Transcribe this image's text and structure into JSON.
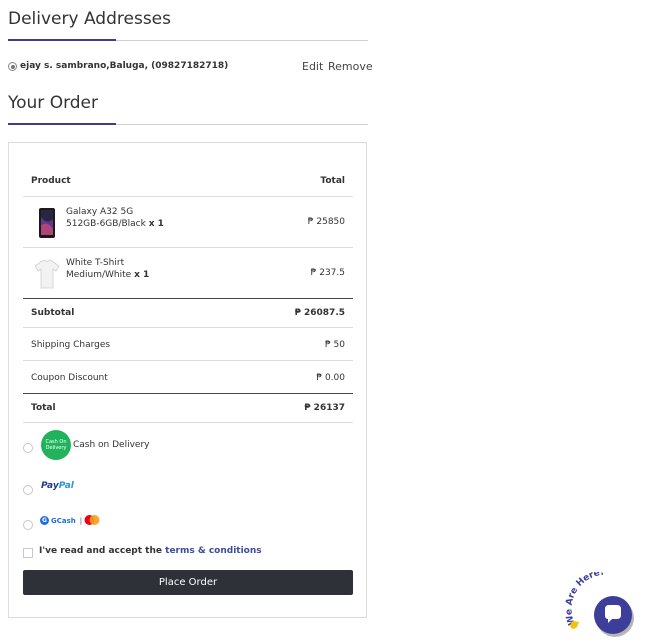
{
  "delivery": {
    "title": "Delivery Addresses",
    "address_text": "ejay s. sambrano,Baluga, (09827182718)",
    "edit_label": "Edit",
    "remove_label": "Remove"
  },
  "order": {
    "title": "Your Order",
    "header": {
      "product": "Product",
      "total": "Total"
    },
    "items": [
      {
        "name_line1": "Galaxy A32 5G",
        "name_line2": "512GB-6GB/Black",
        "qty": "x 1",
        "total": "₱ 25850",
        "image_icon": "phone-image"
      },
      {
        "name_line1": "White T-Shirt",
        "name_line2": "Medium/White",
        "qty": "x 1",
        "total": "₱ 237.5",
        "image_icon": "tshirt-image"
      }
    ],
    "subtotal": {
      "label": "Subtotal",
      "value": "₱ 26087.5"
    },
    "shipping": {
      "label": "Shipping Charges",
      "value": "₱ 50"
    },
    "coupon": {
      "label": "Coupon Discount",
      "value": "₱ 0.00"
    },
    "total": {
      "label": "Total",
      "value": "₱ 26137"
    }
  },
  "payment": {
    "cod_label": "Cash on Delivery",
    "cod_badge_text": "Cash On Delivery",
    "paypal_part1": "Pay",
    "paypal_part2": "Pal",
    "gcash_label": "GCash",
    "gcash_sep": "|"
  },
  "terms": {
    "prefix": "I've read and accept the ",
    "link": "terms & conditions"
  },
  "place_order_label": "Place Order",
  "chat_widget": {
    "arc_text": "We Are Here!",
    "accent": "#3d3d9a"
  },
  "colors": {
    "accent": "#3d3d8f",
    "button": "#2e3138",
    "cod_green": "#21b35c"
  }
}
